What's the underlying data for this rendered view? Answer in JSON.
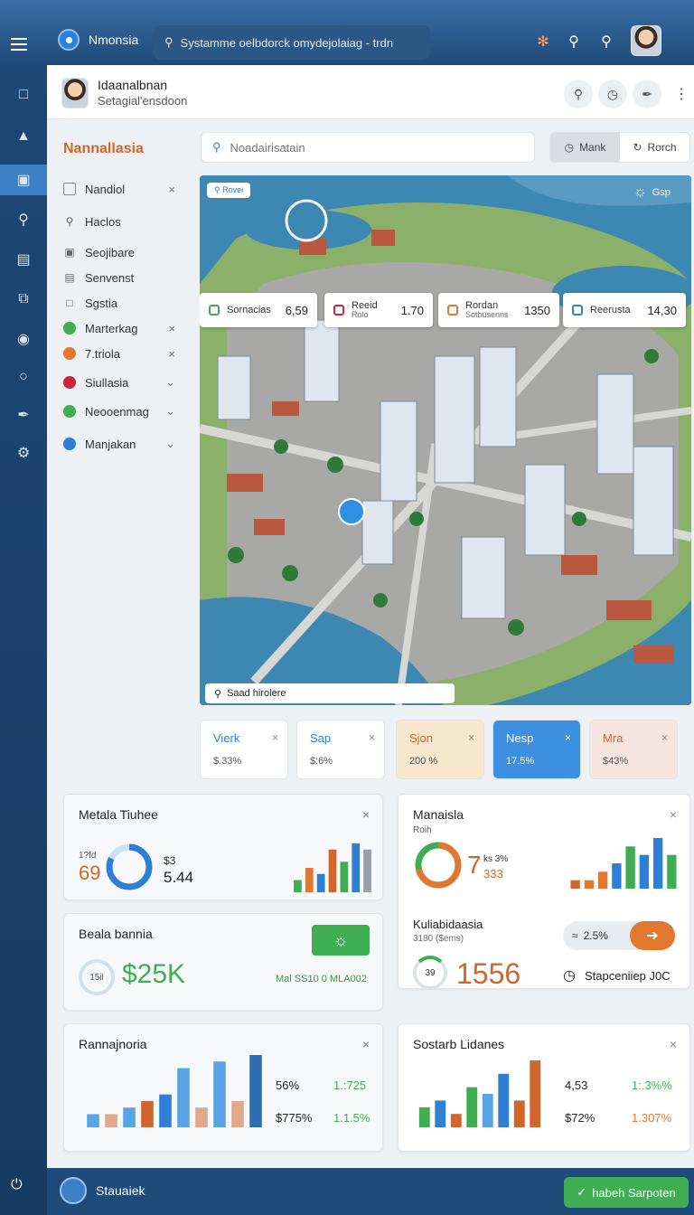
{
  "topbar": {
    "brand": "Nmonsia",
    "search_text": "Systamme oelbdorck omydejolaiag - trdn",
    "icons": [
      "menu-icon",
      "location-pin-icon",
      "search-icon",
      "notification-icon",
      "search-icon",
      "help-icon"
    ]
  },
  "rail": {
    "icons": [
      "home-icon",
      "user-icon",
      "building-icon",
      "search-icon",
      "document-icon",
      "layers-icon",
      "target-icon",
      "circle-icon",
      "tools-icon",
      "gear-icon",
      "power-icon"
    ]
  },
  "header": {
    "name": "Idaanalbnan",
    "subtitle": "Setagial'ensdoon"
  },
  "nav": {
    "title": "Nannallasia",
    "items": [
      {
        "label": "Nandiol",
        "action": "×",
        "color": ""
      },
      {
        "label": "Haclos",
        "action": "",
        "color": ""
      },
      {
        "label": "Seojibare",
        "action": "",
        "color": ""
      },
      {
        "label": "Senvenst",
        "action": "",
        "color": ""
      },
      {
        "label": "Sgstia",
        "action": "",
        "color": ""
      },
      {
        "label": "Marterkag",
        "action": "×",
        "color": "#3fae52"
      },
      {
        "label": "7.triola",
        "action": "×",
        "color": "#e0782f"
      },
      {
        "label": "Siullasia",
        "action": "⌄",
        "color": "#d0243a"
      },
      {
        "label": "Neooenmag",
        "action": "⌄",
        "color": "#3fae52"
      },
      {
        "label": "Manjakan",
        "action": "⌄",
        "color": "#2f7fd6"
      }
    ]
  },
  "map": {
    "search_placeholder": "Noadairisatain",
    "toggle": {
      "left": "Mank",
      "right": "Rorch"
    },
    "badge": "Rovei",
    "corner": "Gsp",
    "bottom_label": "Saad hirolere",
    "chips": [
      {
        "label": "Sornacias",
        "sub": "",
        "value": "6,59",
        "color": "#3fae52"
      },
      {
        "label": "Reeid",
        "sub": "Rolo",
        "value": "1.70",
        "color": "#d0243a"
      },
      {
        "label": "Rordan",
        "sub": "Sotbusenns",
        "value": "1350",
        "color": "#e0782f"
      },
      {
        "label": "Reerusta",
        "sub": "",
        "value": "14,30",
        "color": "#2f7fd6"
      }
    ]
  },
  "tiles": [
    {
      "label": "Vierk",
      "value": "$.33%",
      "bg": "#ffffff",
      "fg": "#2f7fd6"
    },
    {
      "label": "Sap",
      "value": "$:6%",
      "bg": "#ffffff",
      "fg": "#2f7fd6"
    },
    {
      "label": "Sjon",
      "value": "200 %",
      "bg": "#f8e7cf",
      "fg": "#d0662c"
    },
    {
      "label": "Nesp",
      "value": "17.5%",
      "bg": "#3d8fe0",
      "fg": "#ffffff"
    },
    {
      "label": "Mra",
      "value": "$43%",
      "bg": "#f6e4e1",
      "fg": "#d0662c"
    }
  ],
  "cards": {
    "c1": {
      "title": "Metala Tiuhee",
      "small": "1?fd",
      "big": "69",
      "sm2": "$3",
      "val": "5.44",
      "donut": 0.82
    },
    "c2": {
      "title": "Manaisla",
      "sub": "Roih",
      "big": "7",
      "sm": "ks 3%",
      "sm2": "333",
      "donut": 0.72
    },
    "c3": {
      "title": "Beala bannia",
      "circle": "15il",
      "money": "$25K",
      "note": "Mal SS10 0 MLA002"
    },
    "c4": {
      "title": "Kuliabidaasia",
      "sub": "3180 ($ems)",
      "gauge": "39",
      "big": "1556",
      "pct": "2.5%",
      "foot": "Stapceniiep J0C"
    },
    "c5": {
      "title": "Rannajnoria",
      "k1": "56%",
      "v1": "1.:725",
      "k2": "$775%",
      "v2": "1.1.5%"
    },
    "c6": {
      "title": "Sostarb Lidanes",
      "k1": "4,53",
      "v1": "1:.3%%",
      "k2": "$72%",
      "v2": "1.307%"
    }
  },
  "chart_data": [
    {
      "type": "bar",
      "values": [
        2,
        4,
        3,
        7,
        5,
        8,
        7
      ],
      "colors": [
        "#3fae52",
        "#e0782f",
        "#2f7fd6",
        "#d0662c",
        "#3fae52",
        "#2f7fd6",
        "#9aa0a6"
      ]
    },
    {
      "type": "bar",
      "values": [
        1,
        1,
        2,
        3,
        5,
        4,
        6,
        4
      ],
      "colors": [
        "#d0662c",
        "#e0782f",
        "#e0782f",
        "#2f7fd6",
        "#3fae52",
        "#2f7fd6",
        "#2f7fd6",
        "#3fae52"
      ]
    },
    {
      "type": "bar",
      "values": [
        2,
        2,
        3,
        4,
        5,
        9,
        3,
        10,
        4,
        11
      ],
      "colors": [
        "#5aa4e6",
        "#e0a98e",
        "#5aa4e6",
        "#d0662c",
        "#2f7fd6",
        "#5aa4e6",
        "#e0a98e",
        "#5aa4e6",
        "#e0a98e",
        "#2f6fb0"
      ]
    },
    {
      "type": "bar",
      "values": [
        3,
        4,
        2,
        6,
        5,
        8,
        4,
        10
      ],
      "colors": [
        "#3fae52",
        "#2f7fd6",
        "#d0662c",
        "#3fae52",
        "#5aa4e6",
        "#2f7fd6",
        "#d0662c",
        "#d0662c"
      ]
    }
  ],
  "footer": {
    "left": "Stauaiek",
    "button": "habeh Sarpoten"
  }
}
